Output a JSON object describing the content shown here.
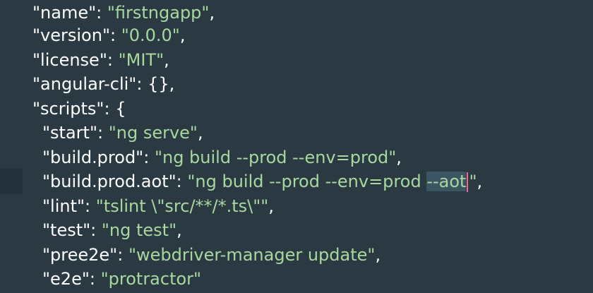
{
  "editor": {
    "lines": [
      {
        "key": "\"name\"",
        "sep": ": ",
        "value": "\"firstngapp\"",
        "end": ","
      },
      {
        "key": "\"version\"",
        "sep": ": ",
        "value": "\"0.0.0\"",
        "end": ","
      },
      {
        "key": "\"license\"",
        "sep": ": ",
        "value": "\"MIT\"",
        "end": ","
      },
      {
        "key": "\"angular-cli\"",
        "sep": ": ",
        "value": "{}",
        "end": ","
      },
      {
        "key": "\"scripts\"",
        "sep": ": ",
        "value": "{",
        "end": ""
      },
      {
        "key": "\"start\"",
        "sep": ": ",
        "value": "\"ng serve\"",
        "end": ","
      },
      {
        "key": "\"build.prod\"",
        "sep": ": ",
        "value": "\"ng build --prod --env=prod\"",
        "end": ","
      },
      {
        "key": "\"build.prod.aot\"",
        "sep": ": ",
        "value_pre": "\"ng build --prod --env=prod ",
        "value_sel": "--aot",
        "value_post": "\"",
        "end": ","
      },
      {
        "key": "\"lint\"",
        "sep": ": ",
        "value": "\"tslint \\\"src/**/*.ts\\\"\"",
        "end": ","
      },
      {
        "key": "\"test\"",
        "sep": ": ",
        "value": "\"ng test\"",
        "end": ","
      },
      {
        "key": "\"pree2e\"",
        "sep": ": ",
        "value": "\"webdriver-manager update\"",
        "end": ","
      },
      {
        "key": "\"e2e\"",
        "sep": ": ",
        "value": "\"protractor\"",
        "end": ""
      }
    ]
  },
  "colors": {
    "background": "#2b3a42",
    "string": "#a8d7a0",
    "key": "#ffffff",
    "caret": "#f06a8b",
    "selection": "#3b5563"
  }
}
